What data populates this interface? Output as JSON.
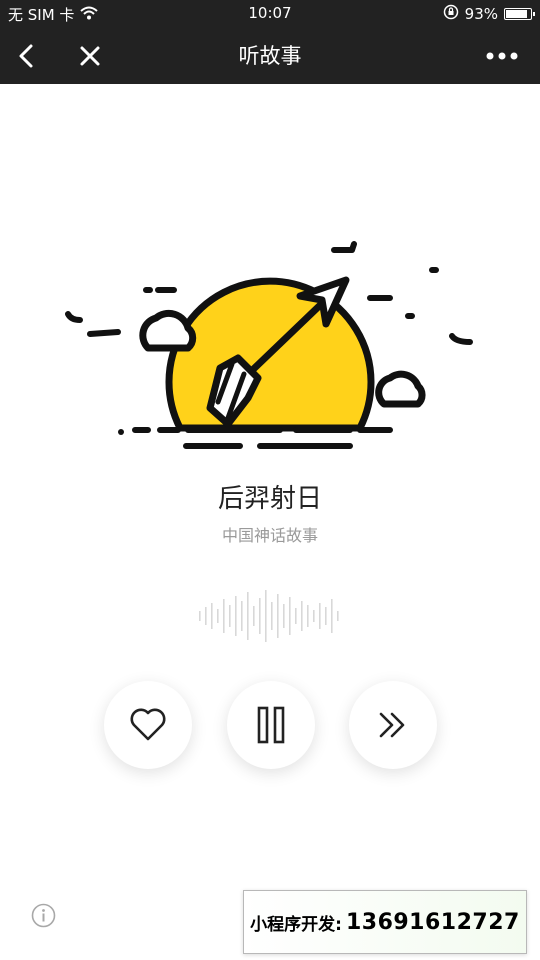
{
  "status_bar": {
    "carrier": "无 SIM 卡",
    "time": "10:07",
    "battery_text": "93%",
    "battery_level": 0.93
  },
  "nav": {
    "title": "听故事"
  },
  "story": {
    "title": "后羿射日",
    "subtitle": "中国神话故事"
  },
  "controls": {
    "favorite_icon": "heart-icon",
    "play_state_icon": "pause-icon",
    "next_icon": "fast-forward-icon"
  },
  "banner": {
    "label": "小程序开发:",
    "phone": "13691612727"
  },
  "colors": {
    "bar_bg": "#222222",
    "sun": "#FFD21A",
    "line": "#111111"
  }
}
